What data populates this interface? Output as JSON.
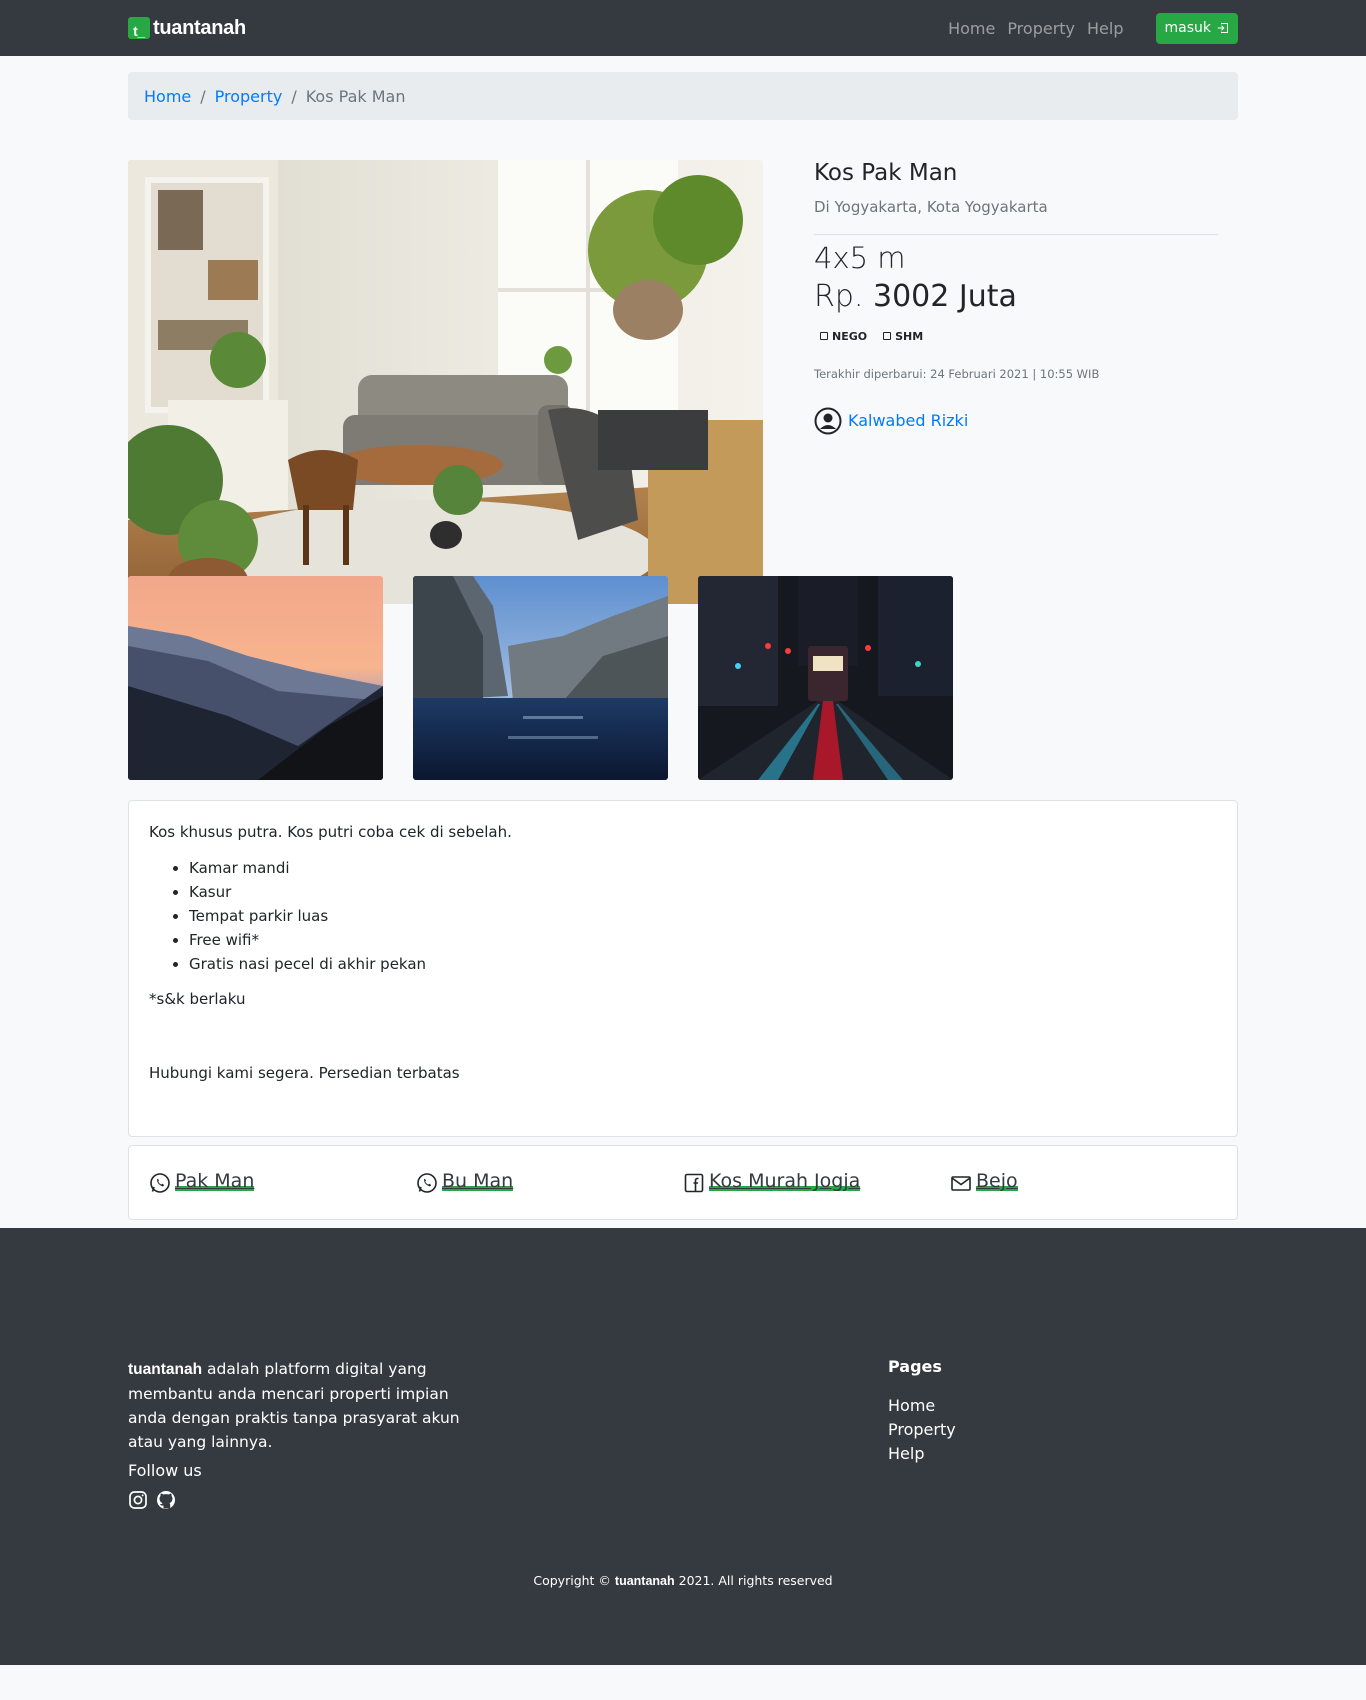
{
  "navbar": {
    "brand_mark": "t_",
    "brand_name": "tuantanah",
    "links": [
      "Home",
      "Property",
      "Help"
    ],
    "login_label": "masuk",
    "login_icon": "box-arrow-in-right-icon"
  },
  "breadcrumb": {
    "items": [
      "Home",
      "Property"
    ],
    "current": "Kos Pak Man"
  },
  "property": {
    "title": "Kos Pak Man",
    "location": "Di Yogyakarta, Kota Yogyakarta",
    "size": "4x5 m",
    "price_currency": "Rp.",
    "price_value": "3002 Juta",
    "badges": [
      "NEGO",
      "SHM"
    ],
    "updated": "Terakhir diperbarui: 24 Februari 2021 | 10:55 WIB",
    "owner": "Kalwabed Rizki",
    "owner_icon": "person-circle-icon"
  },
  "photos": {
    "main": "living-room-photo",
    "thumbs": [
      "mountain-sunset-photo",
      "sea-cliffs-photo",
      "city-street-night-photo"
    ]
  },
  "description": {
    "intro": "Kos khusus putra. Kos putri coba cek di sebelah.",
    "facilities": [
      "Kamar mandi",
      "Kasur",
      "Tempat parkir luas",
      "Free wifi*",
      "Gratis nasi pecel di akhir pekan"
    ],
    "note": "*s&k berlaku",
    "closing": "Hubungi kami segera. Persedian terbatas"
  },
  "contacts": [
    {
      "label": "Pak Man",
      "icon": "whatsapp-icon"
    },
    {
      "label": "Bu Man",
      "icon": "whatsapp-icon"
    },
    {
      "label": "Kos Murah Jogja",
      "icon": "facebook-icon"
    },
    {
      "label": "Bejo",
      "icon": "envelope-icon"
    }
  ],
  "footer": {
    "brand": "tuantanah",
    "about": " adalah platform digital yang membantu anda mencari properti impian anda dengan praktis tanpa prasyarat akun atau yang lainnya.",
    "follow": "Follow us",
    "social_icons": [
      "instagram-icon",
      "github-icon"
    ],
    "pages_title": "Pages",
    "pages": [
      "Home",
      "Property",
      "Help"
    ],
    "copyright_prefix": "Copyright © ",
    "copyright_brand": "tuantanah",
    "copyright_suffix": " 2021. All rights reserved"
  }
}
